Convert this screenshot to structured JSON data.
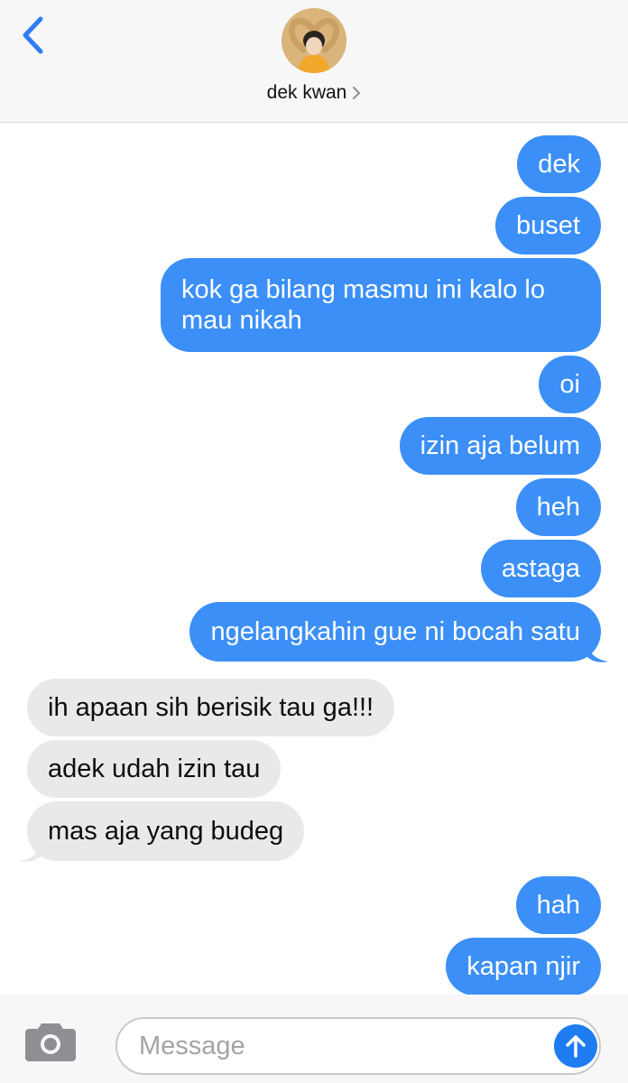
{
  "header": {
    "contact_name": "dek kwan",
    "back_icon": "chevron-left-icon",
    "contact_chevron_icon": "chevron-right-icon"
  },
  "colors": {
    "sent_bubble": "#3b8ff7",
    "received_bubble": "#e9e9eb",
    "accent": "#1f7cf0",
    "header_bg": "#f7f7f7"
  },
  "messages": [
    {
      "from": "me",
      "text": "dek"
    },
    {
      "from": "me",
      "text": "buset"
    },
    {
      "from": "me",
      "text": "kok ga bilang masmu ini kalo lo mau nikah"
    },
    {
      "from": "me",
      "text": "oi"
    },
    {
      "from": "me",
      "text": "izin aja belum"
    },
    {
      "from": "me",
      "text": "heh"
    },
    {
      "from": "me",
      "text": "astaga"
    },
    {
      "from": "me",
      "text": "ngelangkahin gue ni bocah satu"
    },
    {
      "from": "them",
      "text": "ih apaan sih berisik tau ga!!!"
    },
    {
      "from": "them",
      "text": "adek udah izin tau"
    },
    {
      "from": "them",
      "text": "mas aja yang budeg"
    },
    {
      "from": "me",
      "text": "hah"
    },
    {
      "from": "me",
      "text": "kapan njir"
    },
    {
      "from": "me",
      "text": ""
    }
  ],
  "input": {
    "placeholder": "Message",
    "value": "",
    "camera_icon": "camera-icon",
    "send_icon": "arrow-up-icon"
  }
}
